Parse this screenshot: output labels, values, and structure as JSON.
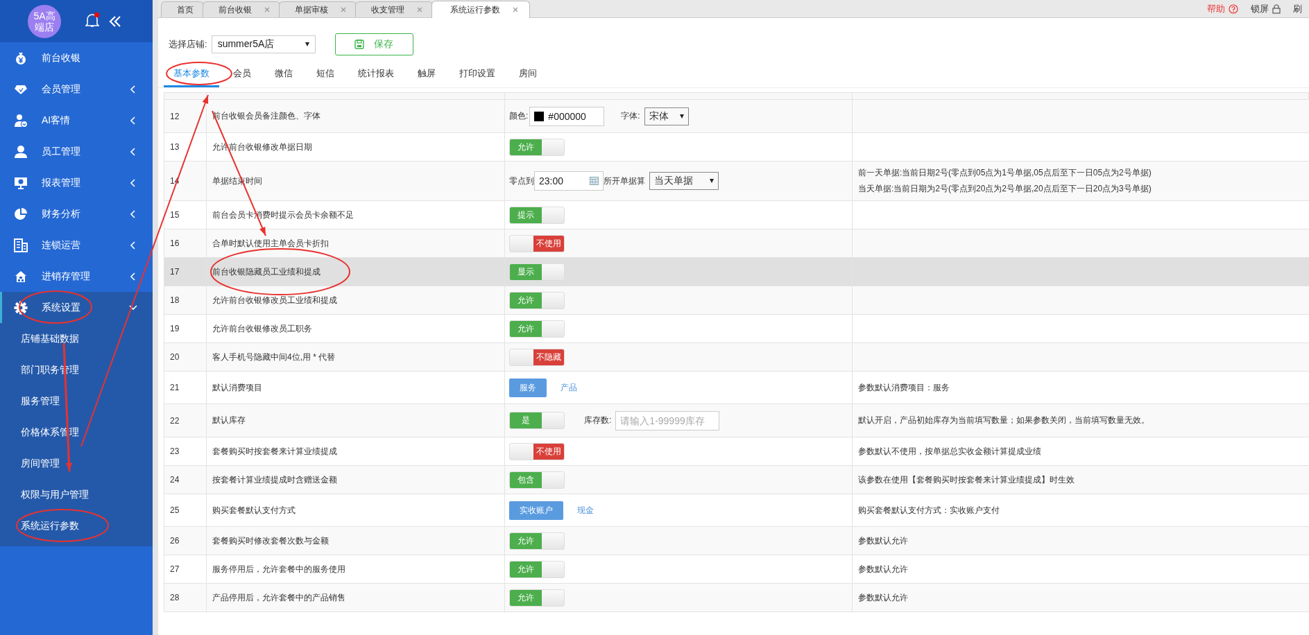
{
  "sidebar": {
    "logo": "5A高端店",
    "notification_dot": true,
    "items": [
      {
        "label": "前台收银",
        "kind": "link"
      },
      {
        "label": "会员管理",
        "kind": "group",
        "expanded": false
      },
      {
        "label": "AI客情",
        "kind": "group",
        "expanded": false
      },
      {
        "label": "员工管理",
        "kind": "group",
        "expanded": false
      },
      {
        "label": "报表管理",
        "kind": "group",
        "expanded": false
      },
      {
        "label": "财务分析",
        "kind": "group",
        "expanded": false
      },
      {
        "label": "连锁运营",
        "kind": "group",
        "expanded": false
      },
      {
        "label": "进销存管理",
        "kind": "group",
        "expanded": false
      },
      {
        "label": "系统设置",
        "kind": "group",
        "expanded": true,
        "children": [
          {
            "label": "店铺基础数据"
          },
          {
            "label": "部门职务管理"
          },
          {
            "label": "服务管理"
          },
          {
            "label": "价格体系管理"
          },
          {
            "label": "房间管理"
          },
          {
            "label": "权限与用户管理"
          },
          {
            "label": "系统运行参数"
          }
        ]
      }
    ]
  },
  "tabs": [
    {
      "label": "首页",
      "closable": false,
      "selected": false
    },
    {
      "label": "前台收银",
      "closable": true,
      "selected": false
    },
    {
      "label": "单据审核",
      "closable": true,
      "selected": false
    },
    {
      "label": "收支管理",
      "closable": true,
      "selected": false
    },
    {
      "label": "系统运行参数",
      "closable": true,
      "selected": true
    }
  ],
  "top_actions": [
    {
      "label": "帮助",
      "kind": "help"
    },
    {
      "label": "锁屏",
      "kind": "lock"
    },
    {
      "label": "刷",
      "kind": "refresh"
    }
  ],
  "toolbar": {
    "store_label": "选择店铺:",
    "store_value": "summer5A店",
    "save_button": "保存"
  },
  "param_tabs": [
    {
      "label": "基本参数",
      "selected": true
    },
    {
      "label": "会员",
      "selected": false
    },
    {
      "label": "微信",
      "selected": false
    },
    {
      "label": "短信",
      "selected": false
    },
    {
      "label": "统计报表",
      "selected": false
    },
    {
      "label": "触屏",
      "selected": false
    },
    {
      "label": "打印设置",
      "selected": false
    },
    {
      "label": "房间",
      "selected": false
    }
  ],
  "rows": [
    {
      "no": "12",
      "name": "前台收银会员备注颜色、字体",
      "kind": "color_font",
      "highlighted": false,
      "color_label": "颜色:",
      "color_value": "#000000",
      "font_label": "字体:",
      "font_value": "宋体"
    },
    {
      "no": "13",
      "name": "允许前台收银修改单据日期",
      "kind": "toggle",
      "highlighted": false,
      "on": true,
      "label": "允许"
    },
    {
      "no": "14",
      "name": "单据结束时间",
      "kind": "time_range",
      "highlighted": false,
      "start_label": "零点到",
      "time_value": "23:00",
      "mode_label": "所开单据算",
      "mode_value": "当天单据",
      "notes": [
        "前一天单据:当前日期2号(零点到05点为1号单据,05点后至下一日05点为2号单据)",
        "当天单据:当前日期为2号(零点到20点为2号单据,20点后至下一日20点为3号单据)"
      ]
    },
    {
      "no": "15",
      "name": "前台会员卡消费时提示会员卡余额不足",
      "kind": "toggle",
      "highlighted": false,
      "on": true,
      "label": "提示"
    },
    {
      "no": "16",
      "name": "合单时默认使用主单会员卡折扣",
      "kind": "toggle",
      "highlighted": false,
      "on": false,
      "label": "不使用"
    },
    {
      "no": "17",
      "name": "前台收银隐藏员工业绩和提成",
      "kind": "toggle",
      "highlighted": true,
      "on": true,
      "label": "显示"
    },
    {
      "no": "18",
      "name": "允许前台收银修改员工业绩和提成",
      "kind": "toggle",
      "highlighted": false,
      "on": true,
      "label": "允许"
    },
    {
      "no": "19",
      "name": "允许前台收银修改员工职务",
      "kind": "toggle",
      "highlighted": false,
      "on": true,
      "label": "允许"
    },
    {
      "no": "20",
      "name": "客人手机号隐藏中间4位,用 * 代替",
      "kind": "toggle",
      "highlighted": false,
      "on": false,
      "label": "不隐藏"
    },
    {
      "no": "21",
      "name": "默认消费项目",
      "kind": "choice",
      "highlighted": false,
      "options": [
        {
          "label": "服务",
          "selected": true
        },
        {
          "label": "产品",
          "selected": false
        }
      ],
      "notes": [
        "参数默认消费项目：服务"
      ]
    },
    {
      "no": "22",
      "name": "默认库存",
      "kind": "toggle_input",
      "highlighted": false,
      "on": true,
      "label": "是",
      "input_label": "库存数:",
      "placeholder": "请输入1-99999库存",
      "notes": [
        "默认开启，产品初始库存为当前填写数量；如果参数关闭，当前填写数量无效。"
      ]
    },
    {
      "no": "23",
      "name": "套餐购买时按套餐来计算业绩提成",
      "kind": "toggle",
      "highlighted": false,
      "on": false,
      "label": "不使用",
      "notes": [
        "参数默认不使用，按单据总实收金额计算提成业绩"
      ]
    },
    {
      "no": "24",
      "name": "按套餐计算业绩提成时含赠送金额",
      "kind": "toggle",
      "highlighted": false,
      "on": true,
      "label": "包含",
      "notes": [
        "该参数在使用【套餐购买时按套餐来计算业绩提成】时生效"
      ]
    },
    {
      "no": "25",
      "name": "购买套餐默认支付方式",
      "kind": "choice",
      "highlighted": false,
      "options": [
        {
          "label": "实收账户",
          "selected": true
        },
        {
          "label": "现金",
          "selected": false
        }
      ],
      "notes": [
        "购买套餐默认支付方式：实收账户支付"
      ]
    },
    {
      "no": "26",
      "name": "套餐购买时修改套餐次数与金额",
      "kind": "toggle",
      "highlighted": false,
      "on": true,
      "label": "允许",
      "notes": [
        "参数默认允许"
      ]
    },
    {
      "no": "27",
      "name": "服务停用后，允许套餐中的服务使用",
      "kind": "toggle",
      "highlighted": false,
      "on": true,
      "label": "允许",
      "notes": [
        "参数默认允许"
      ]
    },
    {
      "no": "28",
      "name": "产品停用后，允许套餐中的产品销售",
      "kind": "toggle",
      "highlighted": false,
      "on": true,
      "label": "允许",
      "notes": [
        "参数默认允许"
      ]
    }
  ]
}
